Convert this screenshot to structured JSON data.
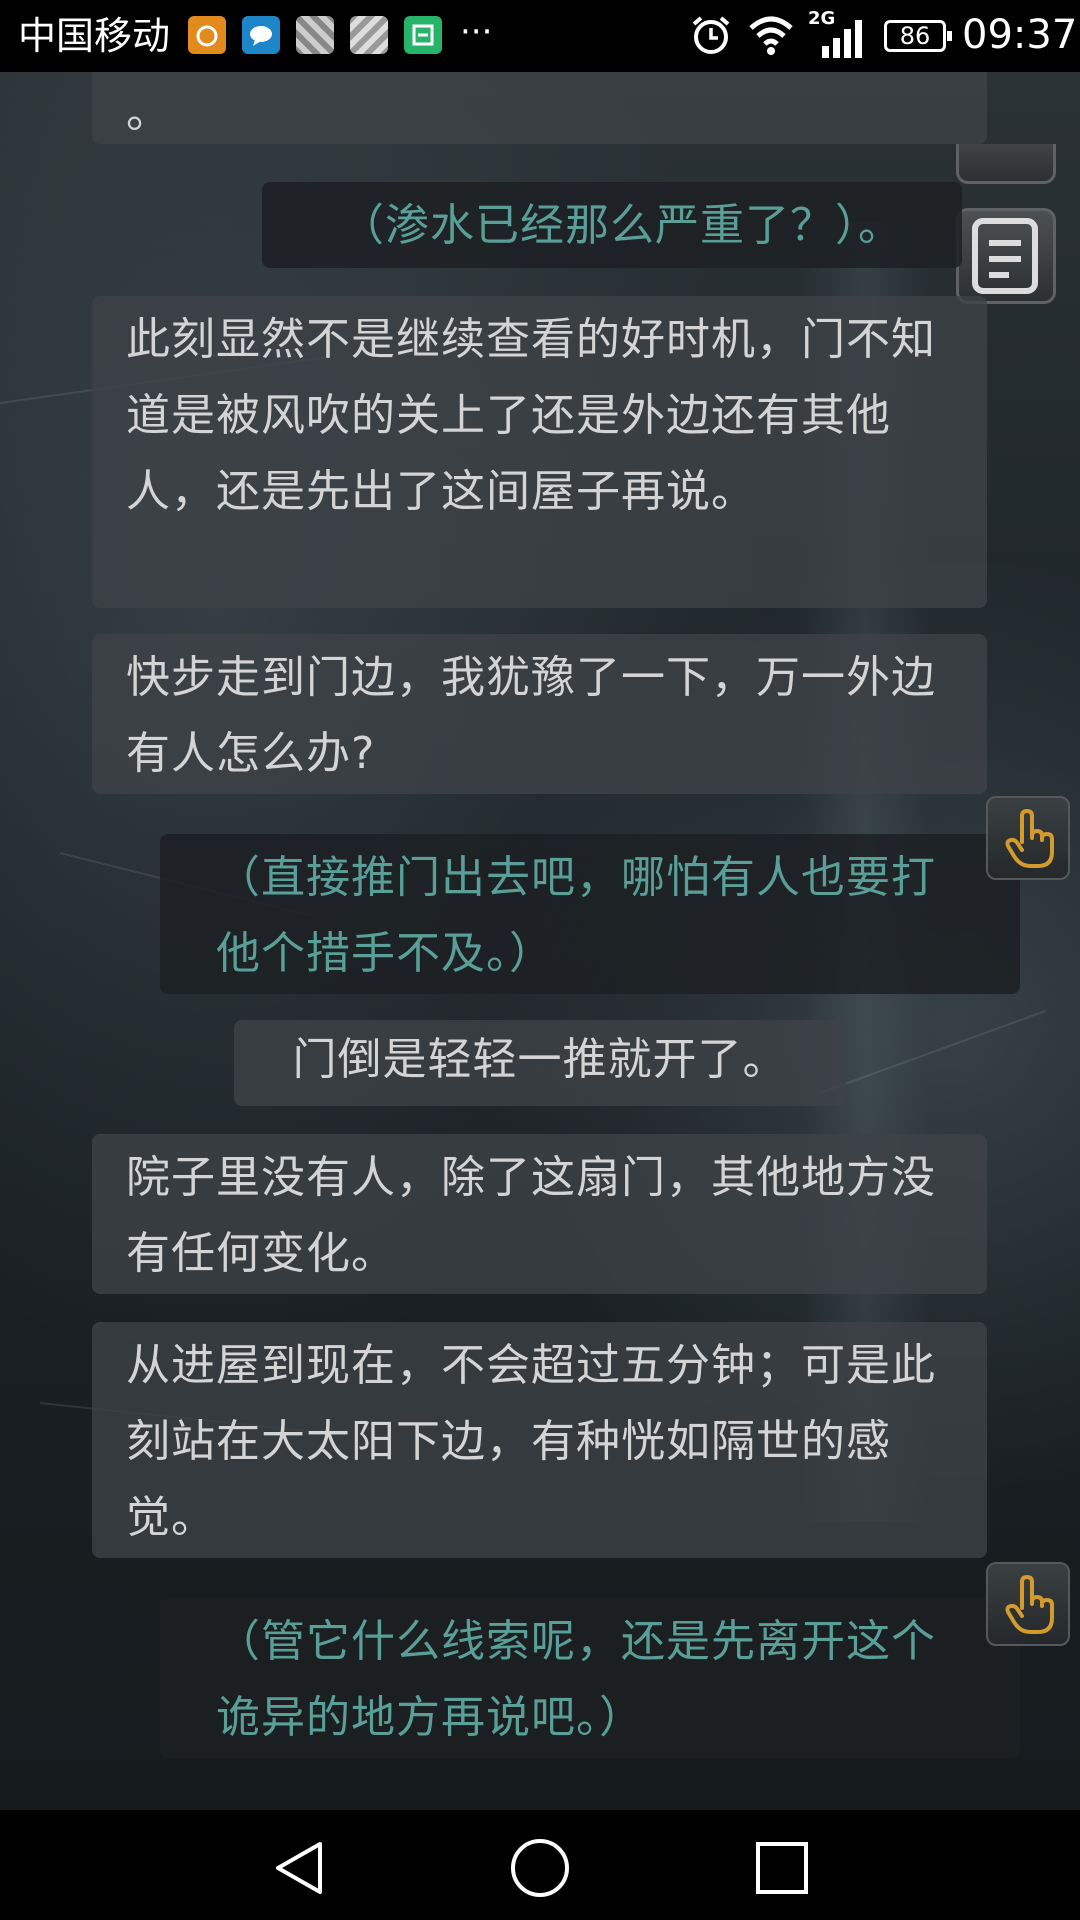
{
  "status_bar": {
    "carrier": "中国移动",
    "notification_overflow": "···",
    "network_type": "2G",
    "battery_level": "86",
    "time": "09:37",
    "icons": [
      "weibo-icon",
      "message-icon",
      "gallery-icon",
      "gallery-icon",
      "calendar-icon",
      "alarm-icon",
      "wifi-icon",
      "signal-icon",
      "battery-icon"
    ]
  },
  "story": {
    "fragment_top": "。",
    "thought_1": "（渗水已经那么严重了？）。",
    "narration_1": "此刻显然不是继续查看的好时机，门不知道是被风吹的关上了还是外边还有其他人，还是先出了这间屋子再说。",
    "narration_2": "快步走到门边，我犹豫了一下，万一外边有人怎么办?",
    "choice_1": "（直接推门出去吧，哪怕有人也要打他个措手不及。）",
    "narration_3": "门倒是轻轻一推就开了。",
    "narration_4": "院子里没有人，除了这扇门，其他地方没有任何变化。",
    "narration_5": "从进屋到现在，不会超过五分钟；可是此刻站在大太阳下边，有种恍如隔世的感觉。",
    "choice_2": "（管它什么线索呢，还是先离开这个诡异的地方再说吧。）"
  },
  "colors": {
    "narration_text": "#d4d4d4",
    "thought_text": "#5a9e98",
    "tap_icon": "#d39a2e"
  }
}
